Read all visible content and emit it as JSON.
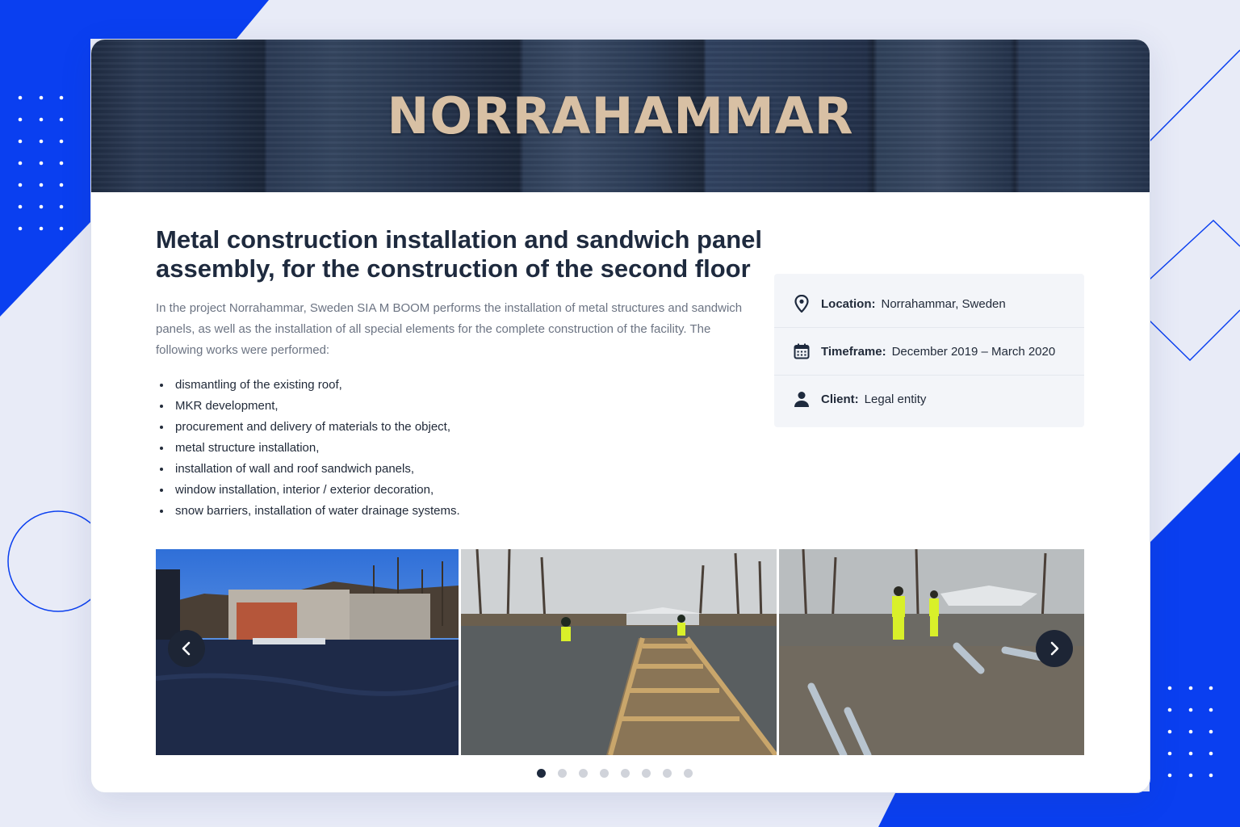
{
  "colors": {
    "accent_blue": "#0a3ff0",
    "title_color": "#1e2a3e",
    "banner_text": "#d8c0a4",
    "page_bg": "#e8ebf7"
  },
  "banner": {
    "title": "NORRAHAMMAR"
  },
  "project": {
    "headline": "Metal construction installation and sandwich panel assembly, for the construction of the second floor",
    "intro": "In the project Norrahammar, Sweden SIA M BOOM performs the installation of metal structures and sandwich panels, as well as the installation of all special elements for the complete construction of the facility. The following works were performed:",
    "works": [
      "dismantling of the existing roof,",
      "MKR development,",
      "procurement and delivery of materials to the object,",
      "metal structure installation,",
      "installation of wall and roof sandwich panels,",
      "window installation, interior / exterior decoration,",
      "snow barriers, installation of water drainage systems."
    ]
  },
  "info": {
    "location": {
      "icon": "location-pin-icon",
      "label": "Location:",
      "value": "Norrahammar, Sweden"
    },
    "timeframe": {
      "icon": "calendar-icon",
      "label": "Timeframe:",
      "value": "December 2019 – March 2020"
    },
    "client": {
      "icon": "user-icon",
      "label": "Client:",
      "value": "Legal entity"
    }
  },
  "gallery": {
    "photos": [
      {
        "subject": "building-exterior-photo"
      },
      {
        "subject": "roof-framing-photo"
      },
      {
        "subject": "workers-on-site-photo"
      }
    ],
    "prev_icon": "chevron-left-icon",
    "next_icon": "chevron-right-icon",
    "dot_count": 8,
    "active_dot": 1
  }
}
